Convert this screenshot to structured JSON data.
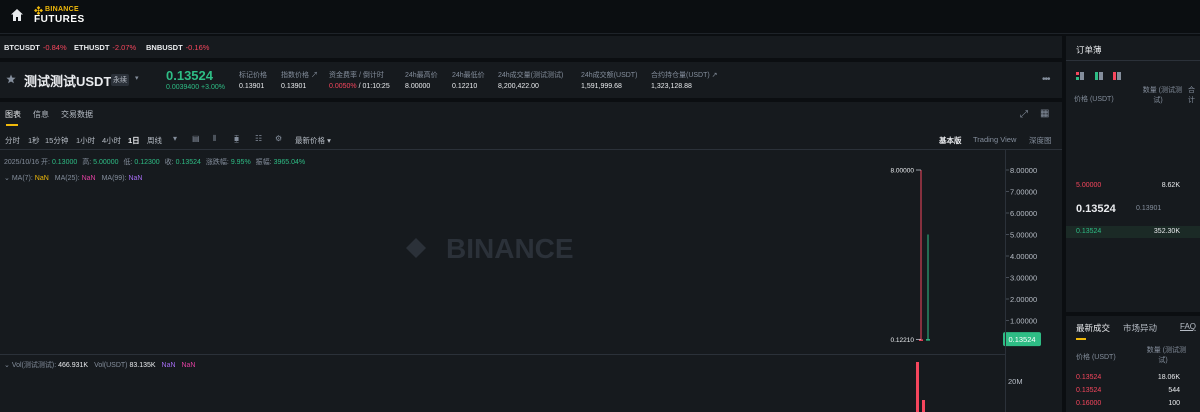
{
  "brand": {
    "top": "BINANCE",
    "bottom": "FUTURES",
    "accent": "#f0b90b"
  },
  "ticker": [
    {
      "symbol": "BTCUSDT",
      "change": "-0.84%"
    },
    {
      "symbol": "ETHUSDT",
      "change": "-2.07%"
    },
    {
      "symbol": "BNBUSDT",
      "change": "-0.16%"
    }
  ],
  "symbol": {
    "name": "测试测试USDT",
    "tag": "永续",
    "last_price": "0.13524",
    "change": "0.0039400 +3.00%"
  },
  "stats": [
    {
      "label": "标记价格",
      "value": "0.13901"
    },
    {
      "label": "指数价格 ↗",
      "value": "0.13901"
    },
    {
      "label": "资金费率 / 倒计时",
      "value_red": "0.0050%",
      "value_rest": " / 01:10:25"
    },
    {
      "label": "24h最高价",
      "value": "8.00000"
    },
    {
      "label": "24h最低价",
      "value": "0.12210"
    },
    {
      "label": "24h成交量(测试测试)",
      "value": "8,200,422.00"
    },
    {
      "label": "24h成交额(USDT)",
      "value": "1,591,999.68"
    },
    {
      "label": "合约持仓量(USDT) ↗",
      "value": "1,323,128.88"
    }
  ],
  "chart_tabs": [
    "图表",
    "信息",
    "交易数据"
  ],
  "timeframes": [
    "分时",
    "1秒",
    "15分钟",
    "1小时",
    "4小时",
    "1日",
    "周线"
  ],
  "price_type": "最新价格 ▾",
  "views": [
    "基本版",
    "Trading View",
    "深度图"
  ],
  "ohlc": {
    "date": "2025/10/16",
    "open_label": "开:",
    "open": "0.13000",
    "high_label": "高:",
    "high": "5.00000",
    "low_label": "低:",
    "low": "0.12300",
    "close_label": "收:",
    "close": "0.13524",
    "chg_label": "涨跌幅:",
    "chg": "9.95%",
    "amp_label": "振幅:",
    "amp": "3965.04%"
  },
  "ma_legend": {
    "ma7_label": "MA(7):",
    "ma7": "NaN",
    "ma25_label": "MA(25):",
    "ma25": "NaN",
    "ma99_label": "MA(99):",
    "ma99": "NaN",
    "colors": {
      "ma7": "#f0b90b",
      "ma25": "#e040a0",
      "ma99": "#a46cf0"
    }
  },
  "vol_legend": {
    "vol_base_label": "Vol(测试测试):",
    "vol_base": "466.931K",
    "vol_usdt_label": "Vol(USDT)",
    "vol_usdt": "83.135K",
    "v1": "NaN",
    "v2": "NaN"
  },
  "watermark": "BINANCE",
  "chart_data": {
    "type": "candlestick",
    "price_axis_ticks": [
      "8.00000",
      "7.00000",
      "6.00000",
      "5.00000",
      "4.00000",
      "3.00000",
      "2.00000",
      "1.00000"
    ],
    "ylim": [
      0,
      8.5
    ],
    "high_marker": "8.00000",
    "low_marker": "0.12210",
    "current_price_label": "0.13524",
    "candles": [
      {
        "open": 0.1221,
        "high": 8.0,
        "low": 0.1221,
        "close": 0.1221,
        "color": "red"
      },
      {
        "open": 0.13,
        "high": 5.0,
        "low": 0.123,
        "close": 0.13524,
        "color": "green"
      }
    ],
    "volume_axis_ticks": [
      "20M"
    ],
    "volume_colors": [
      "red",
      "red"
    ]
  },
  "orderbook": {
    "title": "订单薄",
    "col_price": "价格 (USDT)",
    "col_qty_line1": "数量 (测试测",
    "col_qty_line2": "试)",
    "col_cut_line1": "合",
    "col_cut_line2": "计",
    "ask": {
      "price": "5.00000",
      "qty": "8.62K"
    },
    "mid_price": "0.13524",
    "mark_price": "0.13901",
    "bid": {
      "price": "0.13524",
      "qty": "352.30K"
    }
  },
  "trades": {
    "tab_recent": "最新成交",
    "tab_market": "市场异动",
    "tab_faq": "FAQ",
    "col_price": "价格 (USDT)",
    "col_qty_line1": "数量 (测试测",
    "col_qty_line2": "试)",
    "rows": [
      {
        "price": "0.13524",
        "qty": "18.06K"
      },
      {
        "price": "0.13524",
        "qty": "544"
      },
      {
        "price": "0.16000",
        "qty": "100"
      }
    ]
  }
}
